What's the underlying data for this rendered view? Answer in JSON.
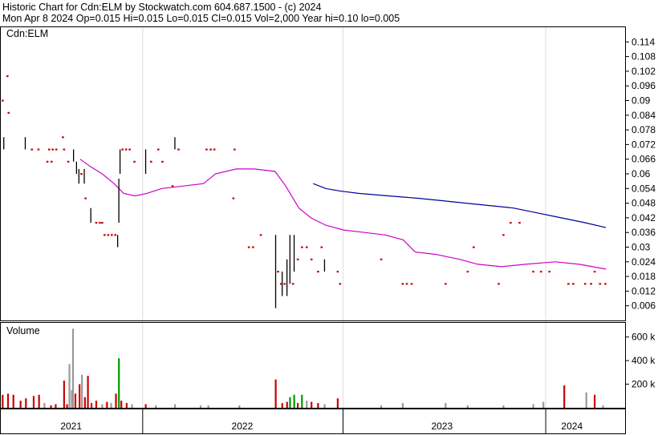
{
  "header": {
    "line1": "Historic Chart for Cdn:ELM by Stockwatch.com 604.687.1500 - (c) 2024",
    "line2": "Mon Apr  8 2024  Op=0.015  Hi=0.015  Lo=0.015  Cl=0.015  Vol=2,000  Year hi=0.10  lo=0.005"
  },
  "colors": {
    "price_bar": "#000000",
    "price_dot": "#cc0000",
    "ma_short": "#cc00cc",
    "ma_long": "#000099",
    "vol_up": "#009900",
    "vol_down": "#cc0000",
    "vol_flat": "#999999",
    "grid": "#dddddd",
    "frame": "#000000"
  },
  "chart_data": [
    {
      "type": "line",
      "title": "Cdn:ELM",
      "ylim": [
        0.0,
        0.12
      ],
      "yticks": [
        "0.114",
        "0.108",
        "0.102",
        "0.096",
        "0.09",
        "0.084",
        "0.078",
        "0.072",
        "0.066",
        "0.06",
        "0.054",
        "0.048",
        "0.042",
        "0.036",
        "0.03",
        "0.024",
        "0.018",
        "0.012",
        "0.006"
      ],
      "xlim": [
        0,
        100
      ],
      "x_labels": [
        {
          "label": "2021",
          "x": 11.8
        },
        {
          "label": "2022",
          "x": 40.5
        },
        {
          "label": "2023",
          "x": 74.0
        },
        {
          "label": "2024",
          "x": 95.8
        }
      ],
      "x_dividers": [
        23.8,
        57.4,
        91.4
      ],
      "price_bars": [
        {
          "x": 0.5,
          "lo": 0.07,
          "hi": 0.075
        },
        {
          "x": 4.1,
          "lo": 0.07,
          "hi": 0.075
        },
        {
          "x": 12.2,
          "lo": 0.065,
          "hi": 0.07
        },
        {
          "x": 12.7,
          "lo": 0.06,
          "hi": 0.065
        },
        {
          "x": 13.1,
          "lo": 0.056,
          "hi": 0.062
        },
        {
          "x": 14.0,
          "lo": 0.056,
          "hi": 0.062
        },
        {
          "x": 15.1,
          "lo": 0.04,
          "hi": 0.046
        },
        {
          "x": 19.6,
          "lo": 0.03,
          "hi": 0.035
        },
        {
          "x": 19.8,
          "lo": 0.04,
          "hi": 0.058
        },
        {
          "x": 20.0,
          "lo": 0.06,
          "hi": 0.07
        },
        {
          "x": 24.3,
          "lo": 0.06,
          "hi": 0.07
        },
        {
          "x": 29.2,
          "lo": 0.07,
          "hi": 0.075
        },
        {
          "x": 46.1,
          "lo": 0.005,
          "hi": 0.035
        },
        {
          "x": 47.2,
          "lo": 0.01,
          "hi": 0.02
        },
        {
          "x": 48.0,
          "lo": 0.01,
          "hi": 0.025
        },
        {
          "x": 48.5,
          "lo": 0.015,
          "hi": 0.035
        },
        {
          "x": 49.2,
          "lo": 0.02,
          "hi": 0.035
        },
        {
          "x": 54.3,
          "lo": 0.02,
          "hi": 0.025
        }
      ],
      "price_points": [
        {
          "x": 1.1,
          "y": 0.1
        },
        {
          "x": 0.3,
          "y": 0.09
        },
        {
          "x": 1.3,
          "y": 0.085
        },
        {
          "x": 5.2,
          "y": 0.07
        },
        {
          "x": 6.3,
          "y": 0.07
        },
        {
          "x": 8.1,
          "y": 0.07
        },
        {
          "x": 8.7,
          "y": 0.07
        },
        {
          "x": 9.3,
          "y": 0.07
        },
        {
          "x": 10.4,
          "y": 0.075
        },
        {
          "x": 10.6,
          "y": 0.07
        },
        {
          "x": 7.8,
          "y": 0.065
        },
        {
          "x": 8.5,
          "y": 0.065
        },
        {
          "x": 11.3,
          "y": 0.065
        },
        {
          "x": 13.5,
          "y": 0.06
        },
        {
          "x": 14.2,
          "y": 0.05
        },
        {
          "x": 16.0,
          "y": 0.04
        },
        {
          "x": 16.6,
          "y": 0.04
        },
        {
          "x": 17.0,
          "y": 0.04
        },
        {
          "x": 17.4,
          "y": 0.035
        },
        {
          "x": 18.0,
          "y": 0.035
        },
        {
          "x": 18.6,
          "y": 0.035
        },
        {
          "x": 19.2,
          "y": 0.035
        },
        {
          "x": 20.4,
          "y": 0.07
        },
        {
          "x": 21.0,
          "y": 0.07
        },
        {
          "x": 21.6,
          "y": 0.07
        },
        {
          "x": 22.4,
          "y": 0.065
        },
        {
          "x": 25.2,
          "y": 0.065
        },
        {
          "x": 26.4,
          "y": 0.07
        },
        {
          "x": 27.1,
          "y": 0.065
        },
        {
          "x": 28.8,
          "y": 0.055
        },
        {
          "x": 29.8,
          "y": 0.07
        },
        {
          "x": 34.5,
          "y": 0.07
        },
        {
          "x": 35.2,
          "y": 0.07
        },
        {
          "x": 35.8,
          "y": 0.07
        },
        {
          "x": 39.2,
          "y": 0.07
        },
        {
          "x": 39.0,
          "y": 0.05
        },
        {
          "x": 41.6,
          "y": 0.03
        },
        {
          "x": 42.3,
          "y": 0.03
        },
        {
          "x": 43.6,
          "y": 0.035
        },
        {
          "x": 46.5,
          "y": 0.02
        },
        {
          "x": 47.0,
          "y": 0.015
        },
        {
          "x": 47.6,
          "y": 0.015
        },
        {
          "x": 49.0,
          "y": 0.015
        },
        {
          "x": 49.8,
          "y": 0.025
        },
        {
          "x": 50.5,
          "y": 0.03
        },
        {
          "x": 51.3,
          "y": 0.03
        },
        {
          "x": 52.1,
          "y": 0.025
        },
        {
          "x": 53.2,
          "y": 0.02
        },
        {
          "x": 53.8,
          "y": 0.03
        },
        {
          "x": 56.5,
          "y": 0.02
        },
        {
          "x": 56.9,
          "y": 0.015
        },
        {
          "x": 63.8,
          "y": 0.025
        },
        {
          "x": 67.4,
          "y": 0.015
        },
        {
          "x": 68.1,
          "y": 0.015
        },
        {
          "x": 68.9,
          "y": 0.015
        },
        {
          "x": 74.6,
          "y": 0.015
        },
        {
          "x": 78.3,
          "y": 0.02
        },
        {
          "x": 79.3,
          "y": 0.03
        },
        {
          "x": 83.5,
          "y": 0.015
        },
        {
          "x": 84.3,
          "y": 0.035
        },
        {
          "x": 85.5,
          "y": 0.04
        },
        {
          "x": 87.0,
          "y": 0.04
        },
        {
          "x": 89.3,
          "y": 0.02
        },
        {
          "x": 90.6,
          "y": 0.02
        },
        {
          "x": 92.0,
          "y": 0.02
        },
        {
          "x": 95.2,
          "y": 0.015
        },
        {
          "x": 96.0,
          "y": 0.015
        },
        {
          "x": 98.0,
          "y": 0.015
        },
        {
          "x": 99.0,
          "y": 0.015
        },
        {
          "x": 99.6,
          "y": 0.02
        },
        {
          "x": 100.5,
          "y": 0.015
        },
        {
          "x": 101.4,
          "y": 0.015
        }
      ],
      "ma_short": [
        {
          "x": 13.3,
          "y": 0.066
        },
        {
          "x": 15.0,
          "y": 0.063
        },
        {
          "x": 17.0,
          "y": 0.06
        },
        {
          "x": 19.0,
          "y": 0.056
        },
        {
          "x": 20.6,
          "y": 0.052
        },
        {
          "x": 22.5,
          "y": 0.051
        },
        {
          "x": 24.5,
          "y": 0.052
        },
        {
          "x": 27.0,
          "y": 0.054
        },
        {
          "x": 30.5,
          "y": 0.055
        },
        {
          "x": 34.0,
          "y": 0.056
        },
        {
          "x": 36.0,
          "y": 0.06
        },
        {
          "x": 39.5,
          "y": 0.062
        },
        {
          "x": 42.5,
          "y": 0.062
        },
        {
          "x": 46.0,
          "y": 0.061
        },
        {
          "x": 47.8,
          "y": 0.055
        },
        {
          "x": 50.0,
          "y": 0.046
        },
        {
          "x": 52.0,
          "y": 0.042
        },
        {
          "x": 54.5,
          "y": 0.039
        },
        {
          "x": 57.5,
          "y": 0.037
        },
        {
          "x": 61.0,
          "y": 0.036
        },
        {
          "x": 64.5,
          "y": 0.035
        },
        {
          "x": 67.5,
          "y": 0.033
        },
        {
          "x": 69.5,
          "y": 0.028
        },
        {
          "x": 73.0,
          "y": 0.027
        },
        {
          "x": 77.0,
          "y": 0.025
        },
        {
          "x": 80.0,
          "y": 0.023
        },
        {
          "x": 84.0,
          "y": 0.022
        },
        {
          "x": 88.0,
          "y": 0.023
        },
        {
          "x": 93.0,
          "y": 0.024
        },
        {
          "x": 97.0,
          "y": 0.023
        },
        {
          "x": 101.5,
          "y": 0.021
        }
      ],
      "ma_long": [
        {
          "x": 52.4,
          "y": 0.056
        },
        {
          "x": 54.5,
          "y": 0.054
        },
        {
          "x": 56.8,
          "y": 0.053
        },
        {
          "x": 60.0,
          "y": 0.052
        },
        {
          "x": 65.0,
          "y": 0.051
        },
        {
          "x": 70.0,
          "y": 0.05
        },
        {
          "x": 74.0,
          "y": 0.049
        },
        {
          "x": 78.0,
          "y": 0.048
        },
        {
          "x": 82.0,
          "y": 0.047
        },
        {
          "x": 86.0,
          "y": 0.046
        },
        {
          "x": 90.0,
          "y": 0.044
        },
        {
          "x": 94.0,
          "y": 0.042
        },
        {
          "x": 98.0,
          "y": 0.04
        },
        {
          "x": 101.5,
          "y": 0.038
        }
      ]
    },
    {
      "type": "bar",
      "title": "Volume",
      "ylim": [
        0,
        720
      ],
      "yticks": [
        "600 k",
        "400 k",
        "200 k"
      ],
      "bars": [
        {
          "x": 0.3,
          "v": 110,
          "c": "down"
        },
        {
          "x": 1.2,
          "v": 120,
          "c": "down"
        },
        {
          "x": 2.1,
          "v": 110,
          "c": "down"
        },
        {
          "x": 3.3,
          "v": 60,
          "c": "down"
        },
        {
          "x": 4.2,
          "v": 80,
          "c": "down"
        },
        {
          "x": 5.5,
          "v": 100,
          "c": "down"
        },
        {
          "x": 6.4,
          "v": 110,
          "c": "down"
        },
        {
          "x": 7.3,
          "v": 40,
          "c": "flat"
        },
        {
          "x": 8.4,
          "v": 20,
          "c": "down"
        },
        {
          "x": 9.2,
          "v": 30,
          "c": "down"
        },
        {
          "x": 10.6,
          "v": 230,
          "c": "down"
        },
        {
          "x": 11.1,
          "v": 30,
          "c": "down"
        },
        {
          "x": 11.5,
          "v": 370,
          "c": "flat"
        },
        {
          "x": 11.9,
          "v": 150,
          "c": "flat"
        },
        {
          "x": 12.1,
          "v": 670,
          "c": "flat"
        },
        {
          "x": 12.5,
          "v": 120,
          "c": "down"
        },
        {
          "x": 13.2,
          "v": 200,
          "c": "down"
        },
        {
          "x": 13.6,
          "v": 280,
          "c": "flat"
        },
        {
          "x": 14.1,
          "v": 90,
          "c": "down"
        },
        {
          "x": 14.6,
          "v": 270,
          "c": "down"
        },
        {
          "x": 15.2,
          "v": 40,
          "c": "down"
        },
        {
          "x": 16.0,
          "v": 60,
          "c": "down"
        },
        {
          "x": 17.0,
          "v": 30,
          "c": "flat"
        },
        {
          "x": 17.8,
          "v": 50,
          "c": "down"
        },
        {
          "x": 18.5,
          "v": 40,
          "c": "flat"
        },
        {
          "x": 19.3,
          "v": 120,
          "c": "down"
        },
        {
          "x": 19.8,
          "v": 420,
          "c": "up"
        },
        {
          "x": 20.2,
          "v": 60,
          "c": "down"
        },
        {
          "x": 21.1,
          "v": 40,
          "c": "down"
        },
        {
          "x": 22.0,
          "v": 30,
          "c": "flat"
        },
        {
          "x": 24.3,
          "v": 30,
          "c": "down"
        },
        {
          "x": 26.0,
          "v": 20,
          "c": "flat"
        },
        {
          "x": 29.2,
          "v": 30,
          "c": "flat"
        },
        {
          "x": 33.5,
          "v": 20,
          "c": "flat"
        },
        {
          "x": 34.8,
          "v": 20,
          "c": "flat"
        },
        {
          "x": 40.0,
          "v": 20,
          "c": "flat"
        },
        {
          "x": 46.1,
          "v": 240,
          "c": "down"
        },
        {
          "x": 47.2,
          "v": 40,
          "c": "down"
        },
        {
          "x": 48.0,
          "v": 50,
          "c": "down"
        },
        {
          "x": 48.5,
          "v": 90,
          "c": "up"
        },
        {
          "x": 49.2,
          "v": 110,
          "c": "up"
        },
        {
          "x": 49.8,
          "v": 40,
          "c": "down"
        },
        {
          "x": 50.5,
          "v": 110,
          "c": "up"
        },
        {
          "x": 51.3,
          "v": 60,
          "c": "flat"
        },
        {
          "x": 52.1,
          "v": 50,
          "c": "down"
        },
        {
          "x": 53.2,
          "v": 40,
          "c": "down"
        },
        {
          "x": 54.3,
          "v": 30,
          "c": "flat"
        },
        {
          "x": 56.5,
          "v": 80,
          "c": "down"
        },
        {
          "x": 63.8,
          "v": 20,
          "c": "flat"
        },
        {
          "x": 67.4,
          "v": 40,
          "c": "flat"
        },
        {
          "x": 74.6,
          "v": 40,
          "c": "flat"
        },
        {
          "x": 78.3,
          "v": 20,
          "c": "flat"
        },
        {
          "x": 84.3,
          "v": 20,
          "c": "flat"
        },
        {
          "x": 89.3,
          "v": 30,
          "c": "flat"
        },
        {
          "x": 91.0,
          "v": 50,
          "c": "flat"
        },
        {
          "x": 94.5,
          "v": 190,
          "c": "down"
        },
        {
          "x": 98.2,
          "v": 130,
          "c": "flat"
        },
        {
          "x": 99.6,
          "v": 110,
          "c": "down"
        },
        {
          "x": 101.0,
          "v": 20,
          "c": "flat"
        }
      ]
    }
  ]
}
